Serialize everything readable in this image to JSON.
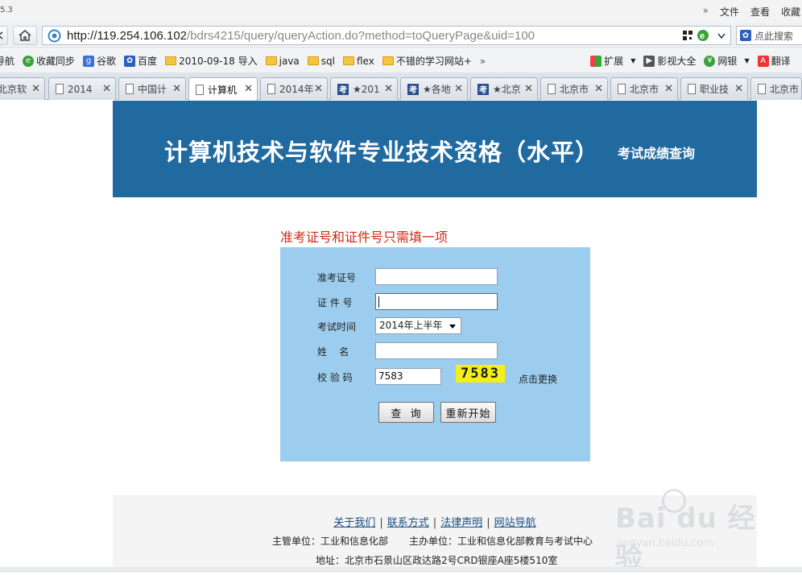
{
  "browser": {
    "version_fragment": "5.3",
    "menus": [
      "文件",
      "查看",
      "收藏"
    ],
    "address_host": "http://119.254.106.102",
    "address_path": "/bdrs4215/query/queryAction.do?method=toQueryPage&uid=100",
    "search_placeholder": "点此搜索",
    "bookmarks": [
      {
        "label": "导航",
        "icon": "nav-icon"
      },
      {
        "label": "收藏同步",
        "icon": "ie-green-icon"
      },
      {
        "label": "谷歌",
        "icon": "google-icon"
      },
      {
        "label": "百度",
        "icon": "baidu-paw-icon"
      },
      {
        "label": "2010-09-18 导入",
        "icon": "folder-icon"
      },
      {
        "label": "java",
        "icon": "folder-icon"
      },
      {
        "label": "sql",
        "icon": "folder-icon"
      },
      {
        "label": "flex",
        "icon": "folder-icon"
      },
      {
        "label": "不错的学习网站+",
        "icon": "folder-icon"
      },
      {
        "label": "»",
        "icon": ""
      },
      {
        "label": "扩展",
        "icon": "extension-icon"
      },
      {
        "label": "影视大全",
        "icon": "video-icon"
      },
      {
        "label": "网银",
        "icon": "bank-icon"
      },
      {
        "label": "翻译",
        "icon": "translate-icon"
      }
    ],
    "tabs": [
      {
        "label": "北京软"
      },
      {
        "label": "2014"
      },
      {
        "label": "中国计"
      },
      {
        "label": "计算机",
        "active": true
      },
      {
        "label": "2014年"
      },
      {
        "label": "★201"
      },
      {
        "label": "★各地"
      },
      {
        "label": "★北京"
      },
      {
        "label": "北京市"
      },
      {
        "label": "北京市"
      },
      {
        "label": "职业技"
      },
      {
        "label": "北京市"
      }
    ]
  },
  "page": {
    "banner_title": "计算机技术与软件专业技术资格（水平）",
    "banner_subtitle": "考试成绩查询",
    "notice": "准考证号和证件号只需填一项",
    "form": {
      "ticket_label": "准考证号",
      "ticket_value": "",
      "id_label": "证 件 号",
      "id_value": "",
      "time_label": "考试时间",
      "time_value": "2014年上半年",
      "name_label": "姓    名",
      "name_value": "",
      "captcha_label": "校 验 码",
      "captcha_value": "7583",
      "captcha_image_text": "7583",
      "refresh_label": "点击更换",
      "query_button": "查  询",
      "reset_button": "重新开始"
    },
    "footer": {
      "links": [
        "关于我们",
        "联系方式",
        "法律声明",
        "网站导航"
      ],
      "sponsor": "主管单位：工业和信息化部",
      "organizer": "主办单位：工业和信息化部教育与考试中心",
      "address": "地址：北京市石景山区政达路2号CRD银座A座5楼510室"
    },
    "watermark": {
      "brand": "Bai du 经验",
      "url": "jingyan.baidu.com"
    }
  },
  "colors": {
    "banner": "#216aa0",
    "form_bg": "#9dcdee",
    "notice": "#cc2a18",
    "captcha_bg": "#f2ef19"
  }
}
